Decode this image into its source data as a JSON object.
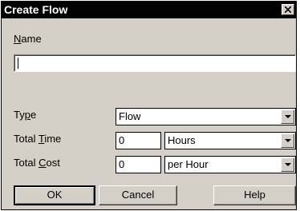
{
  "dialog": {
    "title": "Create Flow",
    "close_glyph": "×"
  },
  "name": {
    "label_pre": "",
    "label_key": "N",
    "label_post": "ame",
    "value": ""
  },
  "type": {
    "label_pre": "Ty",
    "label_key": "p",
    "label_post": "e",
    "selected": "Flow"
  },
  "total_time": {
    "label_pre": "Total ",
    "label_key": "T",
    "label_post": "ime",
    "value": "0",
    "unit_selected": "Hours"
  },
  "total_cost": {
    "label_pre": "Total ",
    "label_key": "C",
    "label_post": "ost",
    "value": "0",
    "unit_selected": "per Hour"
  },
  "buttons": {
    "ok": "OK",
    "cancel": "Cancel",
    "help": "Help"
  }
}
